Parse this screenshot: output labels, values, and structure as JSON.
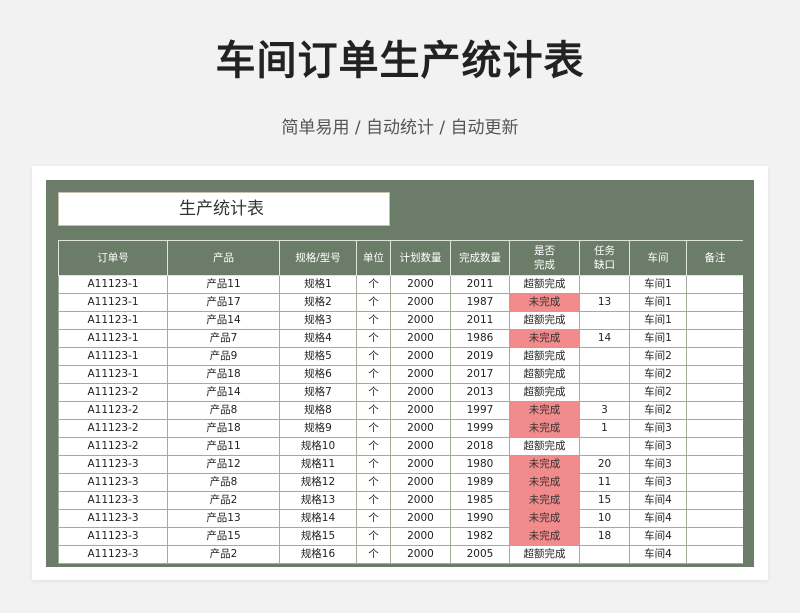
{
  "page": {
    "title": "车间订单生产统计表",
    "subtitle": "简单易用 / 自动统计 / 自动更新"
  },
  "sheet": {
    "title": "生产统计表",
    "colors": {
      "header_bg": "#6b7d68",
      "not_done_bg": "#f28b8b"
    },
    "headers": [
      "订单号",
      "产品",
      "规格/型号",
      "单位",
      "计划数量",
      "完成数量",
      "是否\n完成",
      "任务\n缺口",
      "车间",
      "备注"
    ],
    "rows": [
      [
        "A11123-1",
        "产品11",
        "规格1",
        "个",
        "2000",
        "2011",
        "超额完成",
        "",
        "车间1",
        ""
      ],
      [
        "A11123-1",
        "产品17",
        "规格2",
        "个",
        "2000",
        "1987",
        "未完成",
        "13",
        "车间1",
        ""
      ],
      [
        "A11123-1",
        "产品14",
        "规格3",
        "个",
        "2000",
        "2011",
        "超额完成",
        "",
        "车间1",
        ""
      ],
      [
        "A11123-1",
        "产品7",
        "规格4",
        "个",
        "2000",
        "1986",
        "未完成",
        "14",
        "车间1",
        ""
      ],
      [
        "A11123-1",
        "产品9",
        "规格5",
        "个",
        "2000",
        "2019",
        "超额完成",
        "",
        "车间2",
        ""
      ],
      [
        "A11123-1",
        "产品18",
        "规格6",
        "个",
        "2000",
        "2017",
        "超额完成",
        "",
        "车间2",
        ""
      ],
      [
        "A11123-2",
        "产品14",
        "规格7",
        "个",
        "2000",
        "2013",
        "超额完成",
        "",
        "车间2",
        ""
      ],
      [
        "A11123-2",
        "产品8",
        "规格8",
        "个",
        "2000",
        "1997",
        "未完成",
        "3",
        "车间2",
        ""
      ],
      [
        "A11123-2",
        "产品18",
        "规格9",
        "个",
        "2000",
        "1999",
        "未完成",
        "1",
        "车间3",
        ""
      ],
      [
        "A11123-2",
        "产品11",
        "规格10",
        "个",
        "2000",
        "2018",
        "超额完成",
        "",
        "车间3",
        ""
      ],
      [
        "A11123-3",
        "产品12",
        "规格11",
        "个",
        "2000",
        "1980",
        "未完成",
        "20",
        "车间3",
        ""
      ],
      [
        "A11123-3",
        "产品8",
        "规格12",
        "个",
        "2000",
        "1989",
        "未完成",
        "11",
        "车间3",
        ""
      ],
      [
        "A11123-3",
        "产品2",
        "规格13",
        "个",
        "2000",
        "1985",
        "未完成",
        "15",
        "车间4",
        ""
      ],
      [
        "A11123-3",
        "产品13",
        "规格14",
        "个",
        "2000",
        "1990",
        "未完成",
        "10",
        "车间4",
        ""
      ],
      [
        "A11123-3",
        "产品15",
        "规格15",
        "个",
        "2000",
        "1982",
        "未完成",
        "18",
        "车间4",
        ""
      ],
      [
        "A11123-3",
        "产品2",
        "规格16",
        "个",
        "2000",
        "2005",
        "超额完成",
        "",
        "车间4",
        ""
      ]
    ]
  }
}
